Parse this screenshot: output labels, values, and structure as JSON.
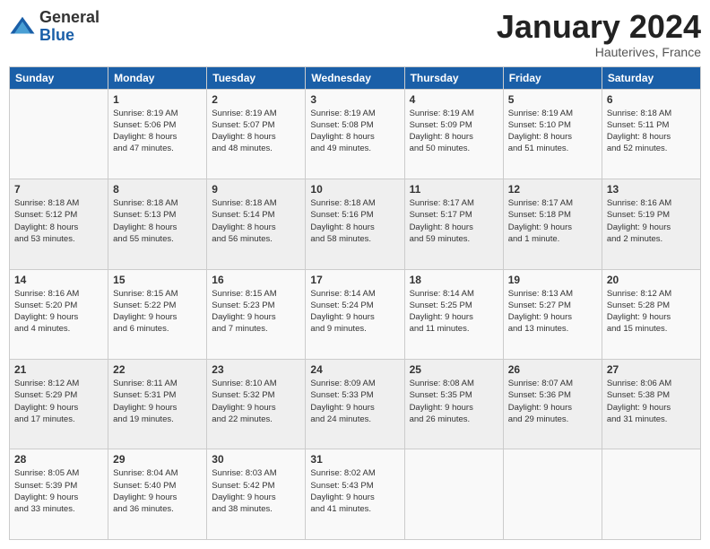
{
  "header": {
    "logo_general": "General",
    "logo_blue": "Blue",
    "title": "January 2024",
    "subtitle": "Hauterives, France"
  },
  "columns": [
    "Sunday",
    "Monday",
    "Tuesday",
    "Wednesday",
    "Thursday",
    "Friday",
    "Saturday"
  ],
  "weeks": [
    [
      {
        "day": "",
        "info": ""
      },
      {
        "day": "1",
        "info": "Sunrise: 8:19 AM\nSunset: 5:06 PM\nDaylight: 8 hours\nand 47 minutes."
      },
      {
        "day": "2",
        "info": "Sunrise: 8:19 AM\nSunset: 5:07 PM\nDaylight: 8 hours\nand 48 minutes."
      },
      {
        "day": "3",
        "info": "Sunrise: 8:19 AM\nSunset: 5:08 PM\nDaylight: 8 hours\nand 49 minutes."
      },
      {
        "day": "4",
        "info": "Sunrise: 8:19 AM\nSunset: 5:09 PM\nDaylight: 8 hours\nand 50 minutes."
      },
      {
        "day": "5",
        "info": "Sunrise: 8:19 AM\nSunset: 5:10 PM\nDaylight: 8 hours\nand 51 minutes."
      },
      {
        "day": "6",
        "info": "Sunrise: 8:18 AM\nSunset: 5:11 PM\nDaylight: 8 hours\nand 52 minutes."
      }
    ],
    [
      {
        "day": "7",
        "info": "Sunrise: 8:18 AM\nSunset: 5:12 PM\nDaylight: 8 hours\nand 53 minutes."
      },
      {
        "day": "8",
        "info": "Sunrise: 8:18 AM\nSunset: 5:13 PM\nDaylight: 8 hours\nand 55 minutes."
      },
      {
        "day": "9",
        "info": "Sunrise: 8:18 AM\nSunset: 5:14 PM\nDaylight: 8 hours\nand 56 minutes."
      },
      {
        "day": "10",
        "info": "Sunrise: 8:18 AM\nSunset: 5:16 PM\nDaylight: 8 hours\nand 58 minutes."
      },
      {
        "day": "11",
        "info": "Sunrise: 8:17 AM\nSunset: 5:17 PM\nDaylight: 8 hours\nand 59 minutes."
      },
      {
        "day": "12",
        "info": "Sunrise: 8:17 AM\nSunset: 5:18 PM\nDaylight: 9 hours\nand 1 minute."
      },
      {
        "day": "13",
        "info": "Sunrise: 8:16 AM\nSunset: 5:19 PM\nDaylight: 9 hours\nand 2 minutes."
      }
    ],
    [
      {
        "day": "14",
        "info": "Sunrise: 8:16 AM\nSunset: 5:20 PM\nDaylight: 9 hours\nand 4 minutes."
      },
      {
        "day": "15",
        "info": "Sunrise: 8:15 AM\nSunset: 5:22 PM\nDaylight: 9 hours\nand 6 minutes."
      },
      {
        "day": "16",
        "info": "Sunrise: 8:15 AM\nSunset: 5:23 PM\nDaylight: 9 hours\nand 7 minutes."
      },
      {
        "day": "17",
        "info": "Sunrise: 8:14 AM\nSunset: 5:24 PM\nDaylight: 9 hours\nand 9 minutes."
      },
      {
        "day": "18",
        "info": "Sunrise: 8:14 AM\nSunset: 5:25 PM\nDaylight: 9 hours\nand 11 minutes."
      },
      {
        "day": "19",
        "info": "Sunrise: 8:13 AM\nSunset: 5:27 PM\nDaylight: 9 hours\nand 13 minutes."
      },
      {
        "day": "20",
        "info": "Sunrise: 8:12 AM\nSunset: 5:28 PM\nDaylight: 9 hours\nand 15 minutes."
      }
    ],
    [
      {
        "day": "21",
        "info": "Sunrise: 8:12 AM\nSunset: 5:29 PM\nDaylight: 9 hours\nand 17 minutes."
      },
      {
        "day": "22",
        "info": "Sunrise: 8:11 AM\nSunset: 5:31 PM\nDaylight: 9 hours\nand 19 minutes."
      },
      {
        "day": "23",
        "info": "Sunrise: 8:10 AM\nSunset: 5:32 PM\nDaylight: 9 hours\nand 22 minutes."
      },
      {
        "day": "24",
        "info": "Sunrise: 8:09 AM\nSunset: 5:33 PM\nDaylight: 9 hours\nand 24 minutes."
      },
      {
        "day": "25",
        "info": "Sunrise: 8:08 AM\nSunset: 5:35 PM\nDaylight: 9 hours\nand 26 minutes."
      },
      {
        "day": "26",
        "info": "Sunrise: 8:07 AM\nSunset: 5:36 PM\nDaylight: 9 hours\nand 29 minutes."
      },
      {
        "day": "27",
        "info": "Sunrise: 8:06 AM\nSunset: 5:38 PM\nDaylight: 9 hours\nand 31 minutes."
      }
    ],
    [
      {
        "day": "28",
        "info": "Sunrise: 8:05 AM\nSunset: 5:39 PM\nDaylight: 9 hours\nand 33 minutes."
      },
      {
        "day": "29",
        "info": "Sunrise: 8:04 AM\nSunset: 5:40 PM\nDaylight: 9 hours\nand 36 minutes."
      },
      {
        "day": "30",
        "info": "Sunrise: 8:03 AM\nSunset: 5:42 PM\nDaylight: 9 hours\nand 38 minutes."
      },
      {
        "day": "31",
        "info": "Sunrise: 8:02 AM\nSunset: 5:43 PM\nDaylight: 9 hours\nand 41 minutes."
      },
      {
        "day": "",
        "info": ""
      },
      {
        "day": "",
        "info": ""
      },
      {
        "day": "",
        "info": ""
      }
    ]
  ]
}
